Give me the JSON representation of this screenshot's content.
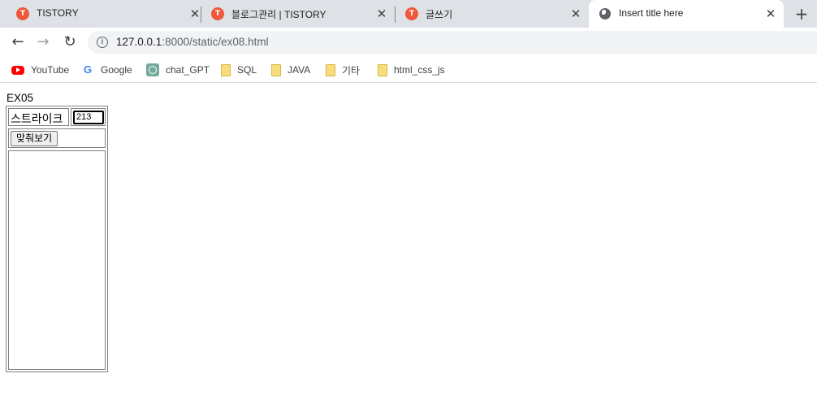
{
  "browser": {
    "tabs": [
      {
        "title": "TISTORY",
        "favicon": "tistory-icon",
        "active": false
      },
      {
        "title": "블로그관리 | TISTORY",
        "favicon": "tistory-icon",
        "active": false
      },
      {
        "title": "글쓰기",
        "favicon": "tistory-icon",
        "active": false
      },
      {
        "title": "Insert title here",
        "favicon": "globe-icon",
        "active": true
      }
    ],
    "close_glyph": "✕",
    "new_tab_glyph": "+",
    "nav": {
      "back": "←",
      "forward": "→",
      "reload": "↻",
      "info": "i"
    },
    "url": {
      "host": "127.0.0.1",
      "rest": ":8000/static/ex08.html"
    },
    "bookmarks": [
      {
        "label": "YouTube",
        "icon": "youtube-icon"
      },
      {
        "label": "Google",
        "icon": "google-icon"
      },
      {
        "label": "chat_GPT",
        "icon": "chatgpt-icon"
      },
      {
        "label": "SQL",
        "icon": "folder-icon"
      },
      {
        "label": "JAVA",
        "icon": "folder-icon"
      },
      {
        "label": "기타",
        "icon": "folder-icon"
      },
      {
        "label": "html_css_js",
        "icon": "folder-icon"
      }
    ],
    "google_glyph": "G"
  },
  "page": {
    "heading": "EX05",
    "label": "스트라이크",
    "input_value": "213",
    "button_label": "맞춰보기",
    "textarea_value": ""
  }
}
